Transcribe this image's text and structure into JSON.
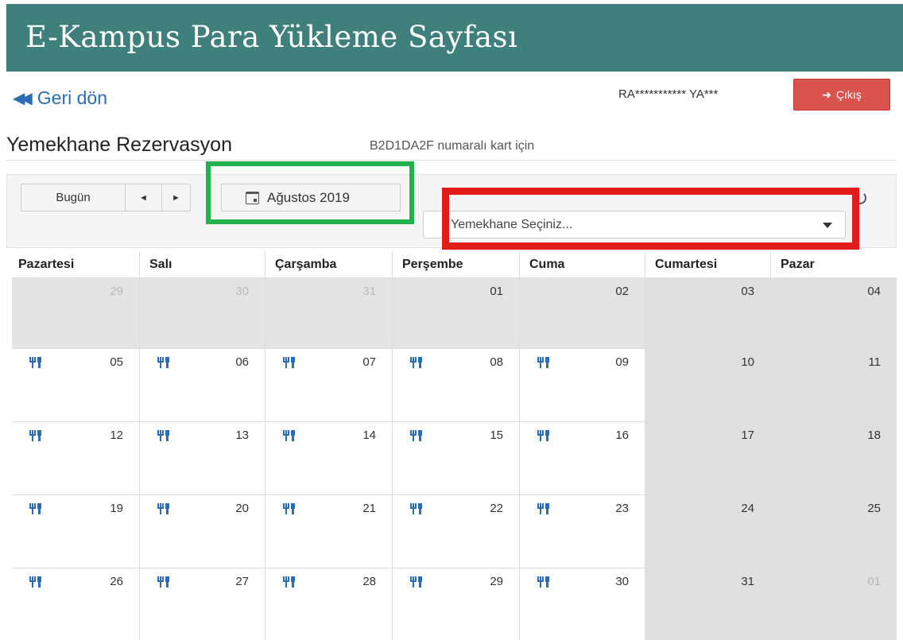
{
  "header": {
    "title": "E-Kampus Para Yükleme Sayfası"
  },
  "nav": {
    "back_label": "Geri dön"
  },
  "user": {
    "name": "RA*********** YA***",
    "logout_label": "Çıkış"
  },
  "page": {
    "title": "Yemekhane Rezervasyon",
    "subtitle": "B2D1DA2F numaralı kart için"
  },
  "toolbar": {
    "today_label": "Bugün",
    "prev_label": "◄",
    "next_label": "►",
    "month_label": "Ağustos 2019",
    "cafeteria_select_value": "Yemekhane Seçiniz..."
  },
  "colors": {
    "header_bg": "#3f7f7c",
    "logout_bg": "#d9534f",
    "link": "#2a6db5",
    "meal_icon": "#2a6db5",
    "highlight_green": "#21b24b",
    "highlight_red": "#e21b1b"
  },
  "calendar": {
    "weekdays": [
      "Pazartesi",
      "Salı",
      "Çarşamba",
      "Perşembe",
      "Cuma",
      "Cumartesi",
      "Pazar"
    ],
    "weeks": [
      [
        {
          "day": "29",
          "other": true,
          "meal": false
        },
        {
          "day": "30",
          "other": true,
          "meal": false
        },
        {
          "day": "31",
          "other": true,
          "meal": false
        },
        {
          "day": "01",
          "other": false,
          "meal": false
        },
        {
          "day": "02",
          "other": false,
          "meal": false
        },
        {
          "day": "03",
          "other": false,
          "meal": false,
          "weekend": true
        },
        {
          "day": "04",
          "other": false,
          "meal": false,
          "weekend": true
        }
      ],
      [
        {
          "day": "05",
          "meal": true
        },
        {
          "day": "06",
          "meal": true
        },
        {
          "day": "07",
          "meal": true
        },
        {
          "day": "08",
          "meal": true
        },
        {
          "day": "09",
          "meal": true
        },
        {
          "day": "10",
          "meal": false,
          "weekend": true
        },
        {
          "day": "11",
          "meal": false,
          "weekend": true
        }
      ],
      [
        {
          "day": "12",
          "meal": true
        },
        {
          "day": "13",
          "meal": true
        },
        {
          "day": "14",
          "meal": true
        },
        {
          "day": "15",
          "meal": true
        },
        {
          "day": "16",
          "meal": true
        },
        {
          "day": "17",
          "meal": false,
          "weekend": true
        },
        {
          "day": "18",
          "meal": false,
          "weekend": true
        }
      ],
      [
        {
          "day": "19",
          "meal": true
        },
        {
          "day": "20",
          "meal": true
        },
        {
          "day": "21",
          "meal": true
        },
        {
          "day": "22",
          "meal": true
        },
        {
          "day": "23",
          "meal": true
        },
        {
          "day": "24",
          "meal": false,
          "weekend": true
        },
        {
          "day": "25",
          "meal": false,
          "weekend": true
        }
      ],
      [
        {
          "day": "26",
          "meal": true
        },
        {
          "day": "27",
          "meal": true
        },
        {
          "day": "28",
          "meal": true
        },
        {
          "day": "29",
          "meal": true
        },
        {
          "day": "30",
          "meal": true
        },
        {
          "day": "31",
          "meal": false,
          "weekend": true
        },
        {
          "day": "01",
          "other": true,
          "meal": false,
          "weekend": true
        }
      ]
    ]
  }
}
